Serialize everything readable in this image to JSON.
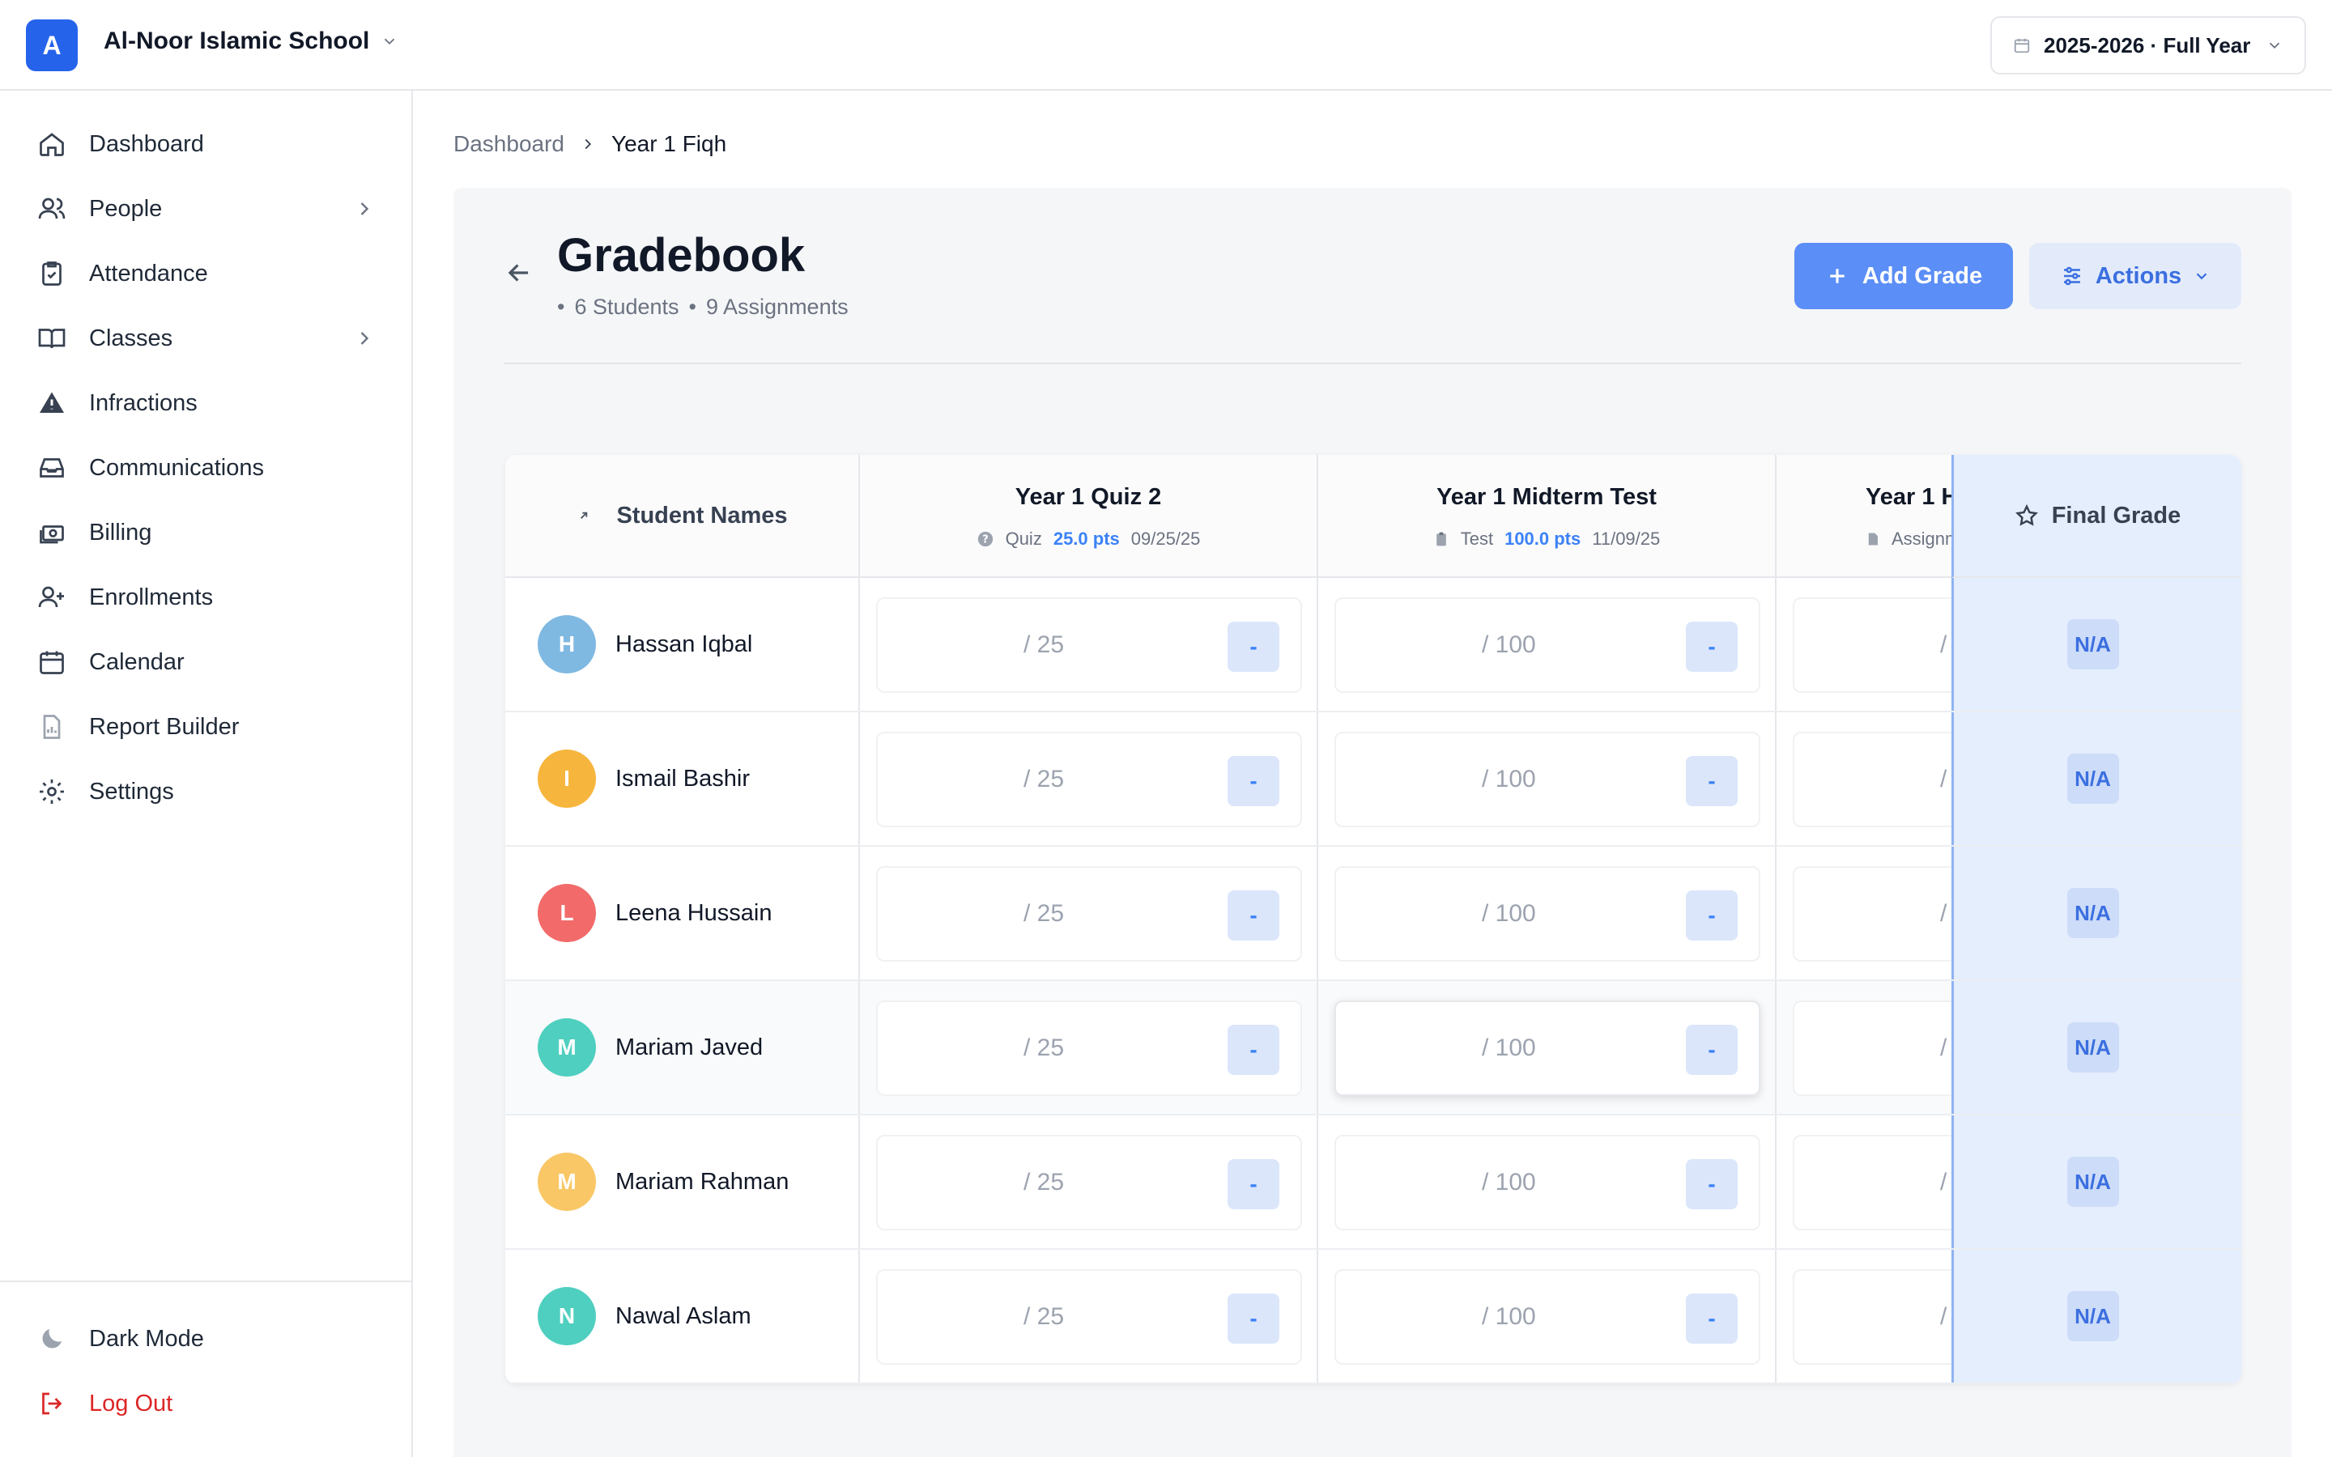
{
  "app": {
    "logo_letter": "A",
    "school_name": "Al-Noor Islamic School",
    "school_year": "2025-2026 · Full Year"
  },
  "sidebar": {
    "items": [
      {
        "label": "Dashboard",
        "icon": "home-icon"
      },
      {
        "label": "People",
        "icon": "users-icon"
      },
      {
        "label": "Attendance",
        "icon": "clipboard-check-icon"
      },
      {
        "label": "Classes",
        "icon": "book-open-icon"
      },
      {
        "label": "Infractions",
        "icon": "warning-icon"
      },
      {
        "label": "Communications",
        "icon": "inbox-icon"
      },
      {
        "label": "Billing",
        "icon": "money-icon"
      },
      {
        "label": "Enrollments",
        "icon": "user-plus-icon"
      },
      {
        "label": "Calendar",
        "icon": "calendar-icon"
      },
      {
        "label": "Report Builder",
        "icon": "report-icon"
      },
      {
        "label": "Settings",
        "icon": "gear-icon"
      }
    ],
    "dark_mode": "Dark Mode",
    "log_out": "Log Out"
  },
  "breadcrumb": {
    "root": "Dashboard",
    "current": "Year 1 Fiqh"
  },
  "header": {
    "title": "Gradebook",
    "students": "6 Students",
    "assignments": "9 Assignments",
    "add_grade": "Add Grade",
    "actions": "Actions"
  },
  "table": {
    "name_header": "Student Names",
    "final_header": "Final Grade",
    "assignments": [
      {
        "title": "Year 1 Quiz 2",
        "type": "Quiz",
        "points": "25.0 pts",
        "date": "09/25/25",
        "max": "/ 25"
      },
      {
        "title": "Year 1 Midterm Test",
        "type": "Test",
        "points": "100.0 pts",
        "date": "11/09/25",
        "max": "/ 100"
      },
      {
        "title": "Year 1 H",
        "type": "Assignm",
        "max": "/"
      }
    ],
    "dash": "-",
    "na": "N/A",
    "students": [
      {
        "initial": "H",
        "name": "Hassan Iqbal",
        "color": "#7fb9e2"
      },
      {
        "initial": "I",
        "name": "Ismail Bashir",
        "color": "#f6b53c"
      },
      {
        "initial": "L",
        "name": "Leena Hussain",
        "color": "#f26a6a"
      },
      {
        "initial": "M",
        "name": "Mariam Javed",
        "color": "#4fcfbf"
      },
      {
        "initial": "M",
        "name": "Mariam Rahman",
        "color": "#f9c766"
      },
      {
        "initial": "N",
        "name": "Nawal Aslam",
        "color": "#4fcfbf"
      }
    ]
  },
  "colors": {
    "primary": "#2563eb",
    "button_primary": "#5b8ef6",
    "final_column": "#e5eefd",
    "danger": "#dc2626"
  }
}
